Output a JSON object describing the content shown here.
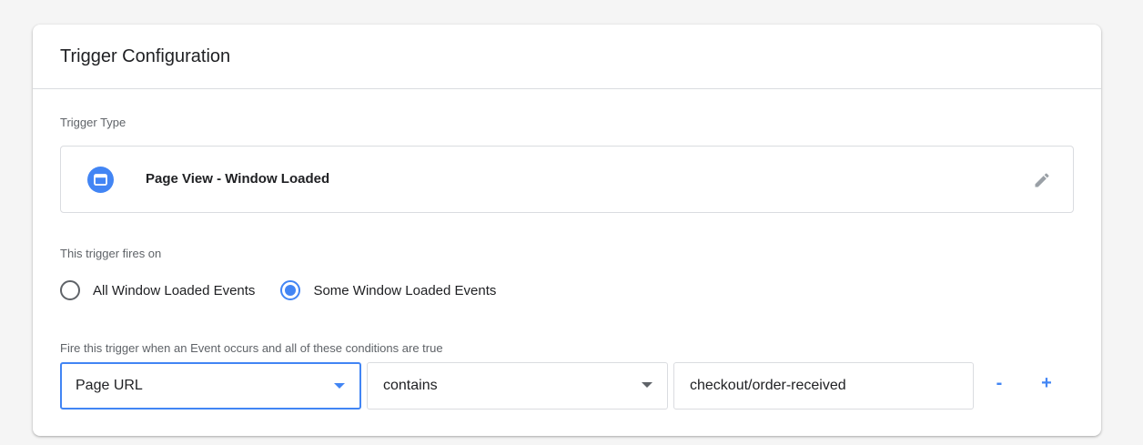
{
  "card": {
    "title": "Trigger Configuration"
  },
  "trigger_type": {
    "label": "Trigger Type",
    "name": "Page View - Window Loaded",
    "icon": "window-icon",
    "edit_icon": "pencil-icon"
  },
  "fires_on": {
    "label": "This trigger fires on",
    "options": [
      {
        "label": "All Window Loaded Events",
        "selected": false
      },
      {
        "label": "Some Window Loaded Events",
        "selected": true
      }
    ]
  },
  "conditions": {
    "label": "Fire this trigger when an Event occurs and all of these conditions are true",
    "variable": "Page URL",
    "operator": "contains",
    "value": "checkout/order-received",
    "remove_label": "-",
    "add_label": "+"
  },
  "colors": {
    "accent": "#4285f4",
    "border": "#dadce0",
    "background": "#f5f5f5"
  }
}
